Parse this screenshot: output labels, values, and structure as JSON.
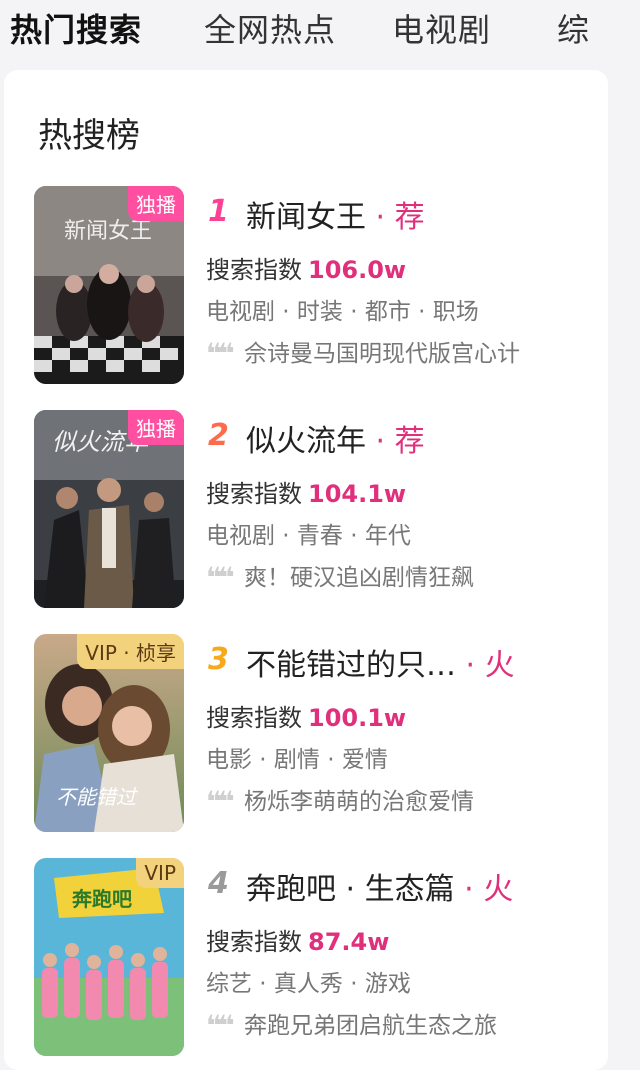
{
  "tabs": [
    "热门搜索",
    "全网热点",
    "电视剧",
    "综"
  ],
  "section_title": "热搜榜",
  "heat_label": "搜索指数",
  "items": [
    {
      "rank": "1",
      "rank_color": "#ff3f93",
      "title": "新闻女王",
      "tag": " · 荐",
      "badge": "独播",
      "heat": "106.0w",
      "genres": "电视剧 · 时装 · 都市 · 职场",
      "desc": "佘诗曼马国明现代版宫心计"
    },
    {
      "rank": "2",
      "rank_color": "#ff6b4a",
      "title": "似火流年",
      "tag": " · 荐",
      "badge": "独播",
      "heat": "104.1w",
      "genres": "电视剧 · 青春 · 年代",
      "desc": "爽！硬汉追凶剧情狂飙"
    },
    {
      "rank": "3",
      "rank_color": "#f7a91b",
      "title": "不能错过的只…",
      "tag": " · 火",
      "badge": "VIP · 桢享",
      "heat": "100.1w",
      "genres": "电影 · 剧情 · 爱情",
      "desc": "杨烁李萌萌的治愈爱情"
    },
    {
      "rank": "4",
      "rank_color": "#9a9a9a",
      "title": "奔跑吧 · 生态篇",
      "tag": " · 火",
      "badge": "VIP",
      "heat": "87.4w",
      "genres": "综艺 · 真人秀 · 游戏",
      "desc": "奔跑兄弟团启航生态之旅"
    }
  ]
}
